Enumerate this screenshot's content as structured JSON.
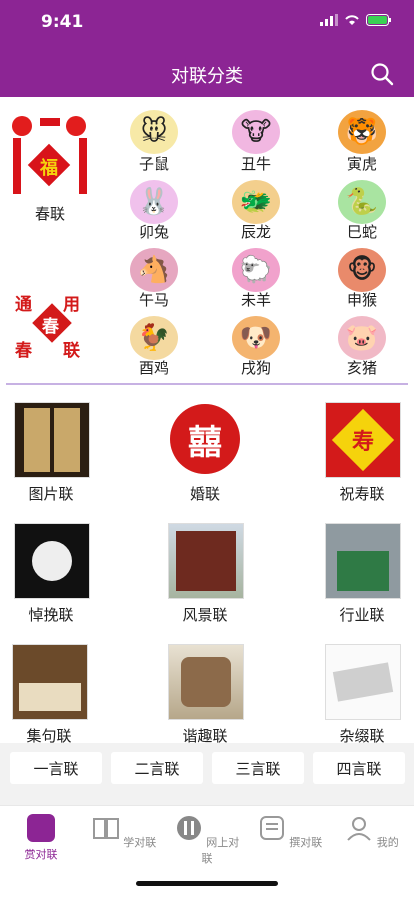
{
  "status": {
    "time": "9:41"
  },
  "header": {
    "title": "对联分类"
  },
  "zodiac": {
    "chunlian_label": "春联",
    "fu_char": "福",
    "tongyong_chars": [
      "通",
      "用",
      "春",
      "联",
      "春"
    ],
    "animals": [
      {
        "label": "子鼠",
        "icon": "rat-icon"
      },
      {
        "label": "丑牛",
        "icon": "ox-icon"
      },
      {
        "label": "寅虎",
        "icon": "tiger-icon"
      },
      {
        "label": "卯兔",
        "icon": "rabbit-icon"
      },
      {
        "label": "辰龙",
        "icon": "dragon-icon"
      },
      {
        "label": "巳蛇",
        "icon": "snake-icon"
      },
      {
        "label": "午马",
        "icon": "horse-icon"
      },
      {
        "label": "未羊",
        "icon": "goat-icon"
      },
      {
        "label": "申猴",
        "icon": "monkey-icon"
      },
      {
        "label": "酉鸡",
        "icon": "rooster-icon"
      },
      {
        "label": "戌狗",
        "icon": "dog-icon"
      },
      {
        "label": "亥猪",
        "icon": "pig-icon"
      }
    ]
  },
  "categories": [
    {
      "label": "图片联"
    },
    {
      "label": "婚联",
      "glyph": "囍"
    },
    {
      "label": "祝寿联",
      "glyph": "寿"
    },
    {
      "label": "悼挽联"
    },
    {
      "label": "风景联"
    },
    {
      "label": "行业联"
    },
    {
      "label": "集句联"
    },
    {
      "label": "谐趣联"
    },
    {
      "label": "杂缀联"
    }
  ],
  "tags": [
    "一言联",
    "二言联",
    "三言联",
    "四言联"
  ],
  "tabbar": [
    {
      "label": "赏对联",
      "active": true
    },
    {
      "label": "学对联"
    },
    {
      "label": "网上对联"
    },
    {
      "label": "撰对联"
    },
    {
      "label": "我的"
    }
  ],
  "colors": {
    "brand": "#8c2594",
    "divider": "#c7b1e3"
  }
}
